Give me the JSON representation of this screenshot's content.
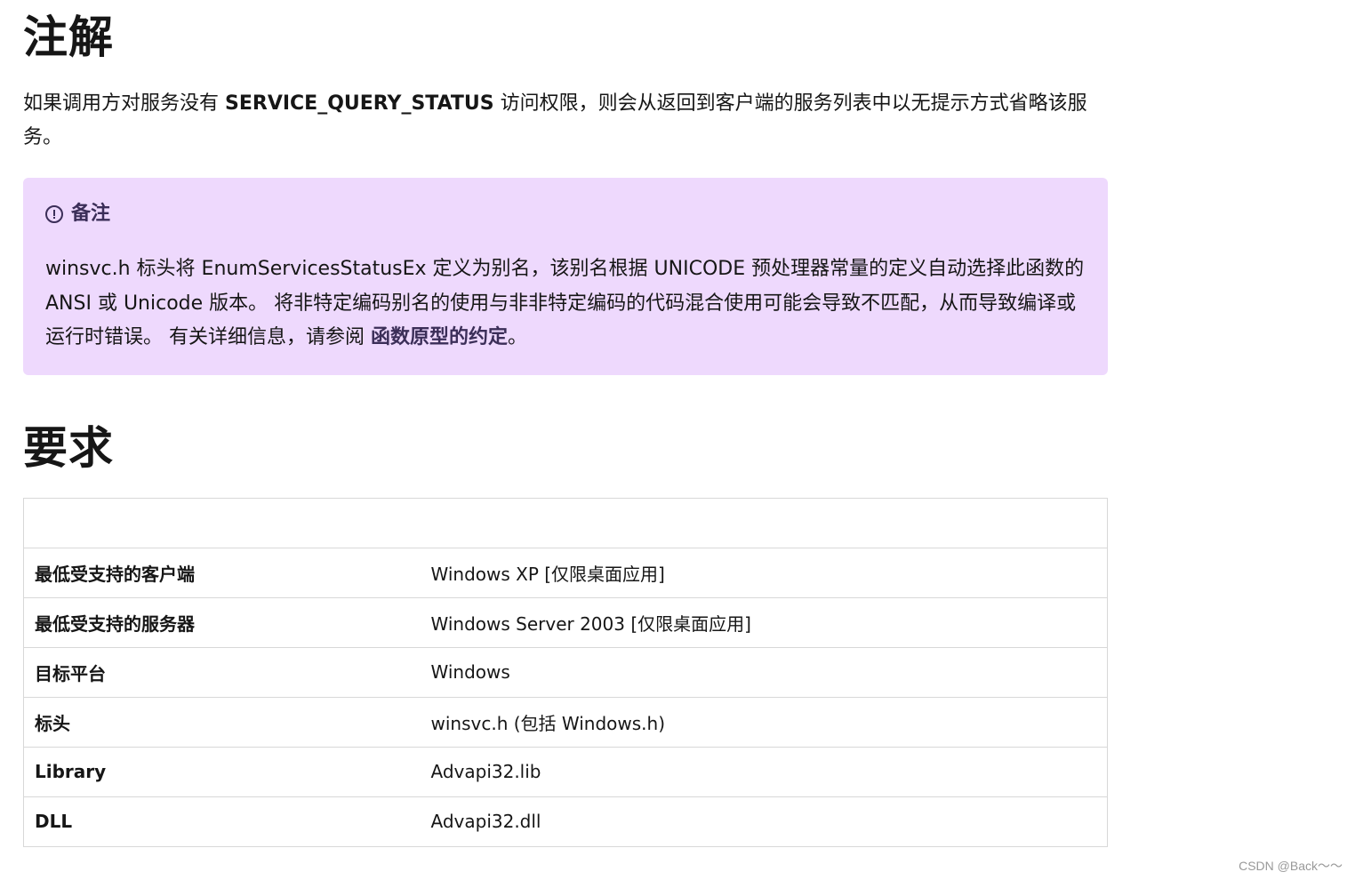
{
  "remarks": {
    "heading": "注解",
    "text_before": "如果调用方对服务没有 ",
    "text_bold": "SERVICE_QUERY_STATUS",
    "text_after": " 访问权限，则会从返回到客户端的服务列表中以无提示方式省略该服务。"
  },
  "note": {
    "icon": "info-circle-icon",
    "title": "备注",
    "body": "winsvc.h 标头将 EnumServicesStatusEx 定义为别名，该别名根据 UNICODE 预处理器常量的定义自动选择此函数的 ANSI 或 Unicode 版本。 将非特定编码别名的使用与非非特定编码的代码混合使用可能会导致不匹配，从而导致编译或运行时错误。 有关详细信息，请参阅 ",
    "link_text": "函数原型的约定",
    "suffix": "。"
  },
  "requirements": {
    "heading": "要求",
    "rows": [
      {
        "label": "最低受支持的客户端",
        "value": "Windows XP [仅限桌面应用]"
      },
      {
        "label": "最低受支持的服务器",
        "value": "Windows Server 2003 [仅限桌面应用]"
      },
      {
        "label": "目标平台",
        "value": "Windows"
      },
      {
        "label": "标头",
        "value": "winsvc.h (包括 Windows.h)"
      },
      {
        "label": "Library",
        "value": "Advapi32.lib"
      },
      {
        "label": "DLL",
        "value": "Advapi32.dll"
      }
    ]
  },
  "watermark": "CSDN @Back～～",
  "colors": {
    "note_background": "#eed9fd",
    "note_accent": "#3b2e58",
    "table_border": "#d8d8d8"
  }
}
